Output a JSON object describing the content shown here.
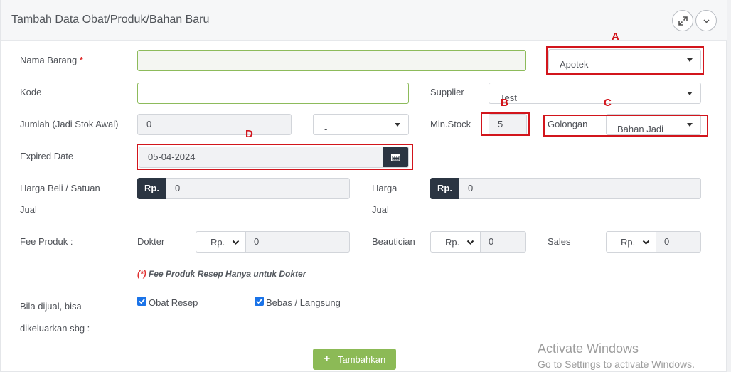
{
  "header": {
    "title": "Tambah Data Obat/Produk/Bahan Baru"
  },
  "form": {
    "nama_barang": {
      "label": "Nama Barang",
      "required_mark": "*",
      "value": ""
    },
    "kode": {
      "label": "Kode",
      "value": ""
    },
    "jumlah": {
      "label": "Jumlah (Jadi Stok Awal)",
      "value": "0",
      "unit_select": "-"
    },
    "expired": {
      "label": "Expired Date",
      "value": "05-04-2024"
    },
    "harga_beli": {
      "label_line1": "Harga Beli / Satuan",
      "label_line2": "Jual",
      "addon": "Rp.",
      "value": "0"
    },
    "harga_jual": {
      "label_line1": "Harga",
      "label_line2": "Jual",
      "addon": "Rp.",
      "value": "0"
    },
    "tipe_select": {
      "value": "Apotek"
    },
    "supplier": {
      "label": "Supplier",
      "value": "Test"
    },
    "min_stock": {
      "label": "Min.Stock",
      "value": "5"
    },
    "golongan": {
      "label": "Golongan",
      "value": "Bahan Jadi"
    },
    "fee": {
      "label": "Fee Produk :",
      "dokter": {
        "label": "Dokter",
        "currency": "Rp.",
        "value": "0"
      },
      "beautician": {
        "label": "Beautician",
        "currency": "Rp.",
        "value": "0"
      },
      "sales": {
        "label": "Sales",
        "currency": "Rp.",
        "value": "0"
      }
    },
    "note": {
      "star": "(*)",
      "text": " Fee Produk Resep Hanya untuk Dokter"
    },
    "dijual": {
      "label_line1": "Bila dijual, bisa",
      "label_line2": "dikeluarkan sbg :",
      "opt1": {
        "label": "Obat Resep",
        "checked": true
      },
      "opt2": {
        "label": "Bebas / Langsung",
        "checked": true
      }
    },
    "submit": {
      "label": "Tambahkan"
    }
  },
  "annotations": {
    "a": "A",
    "b": "B",
    "c": "C",
    "d": "D"
  },
  "watermark": {
    "line1": "Activate Windows",
    "line2": "Go to Settings to activate Windows."
  },
  "colors": {
    "accent_dark": "#2b3542",
    "button_green": "#8cba56",
    "annotation_red": "#d2151c",
    "checkbox_blue": "#1a73e8"
  }
}
